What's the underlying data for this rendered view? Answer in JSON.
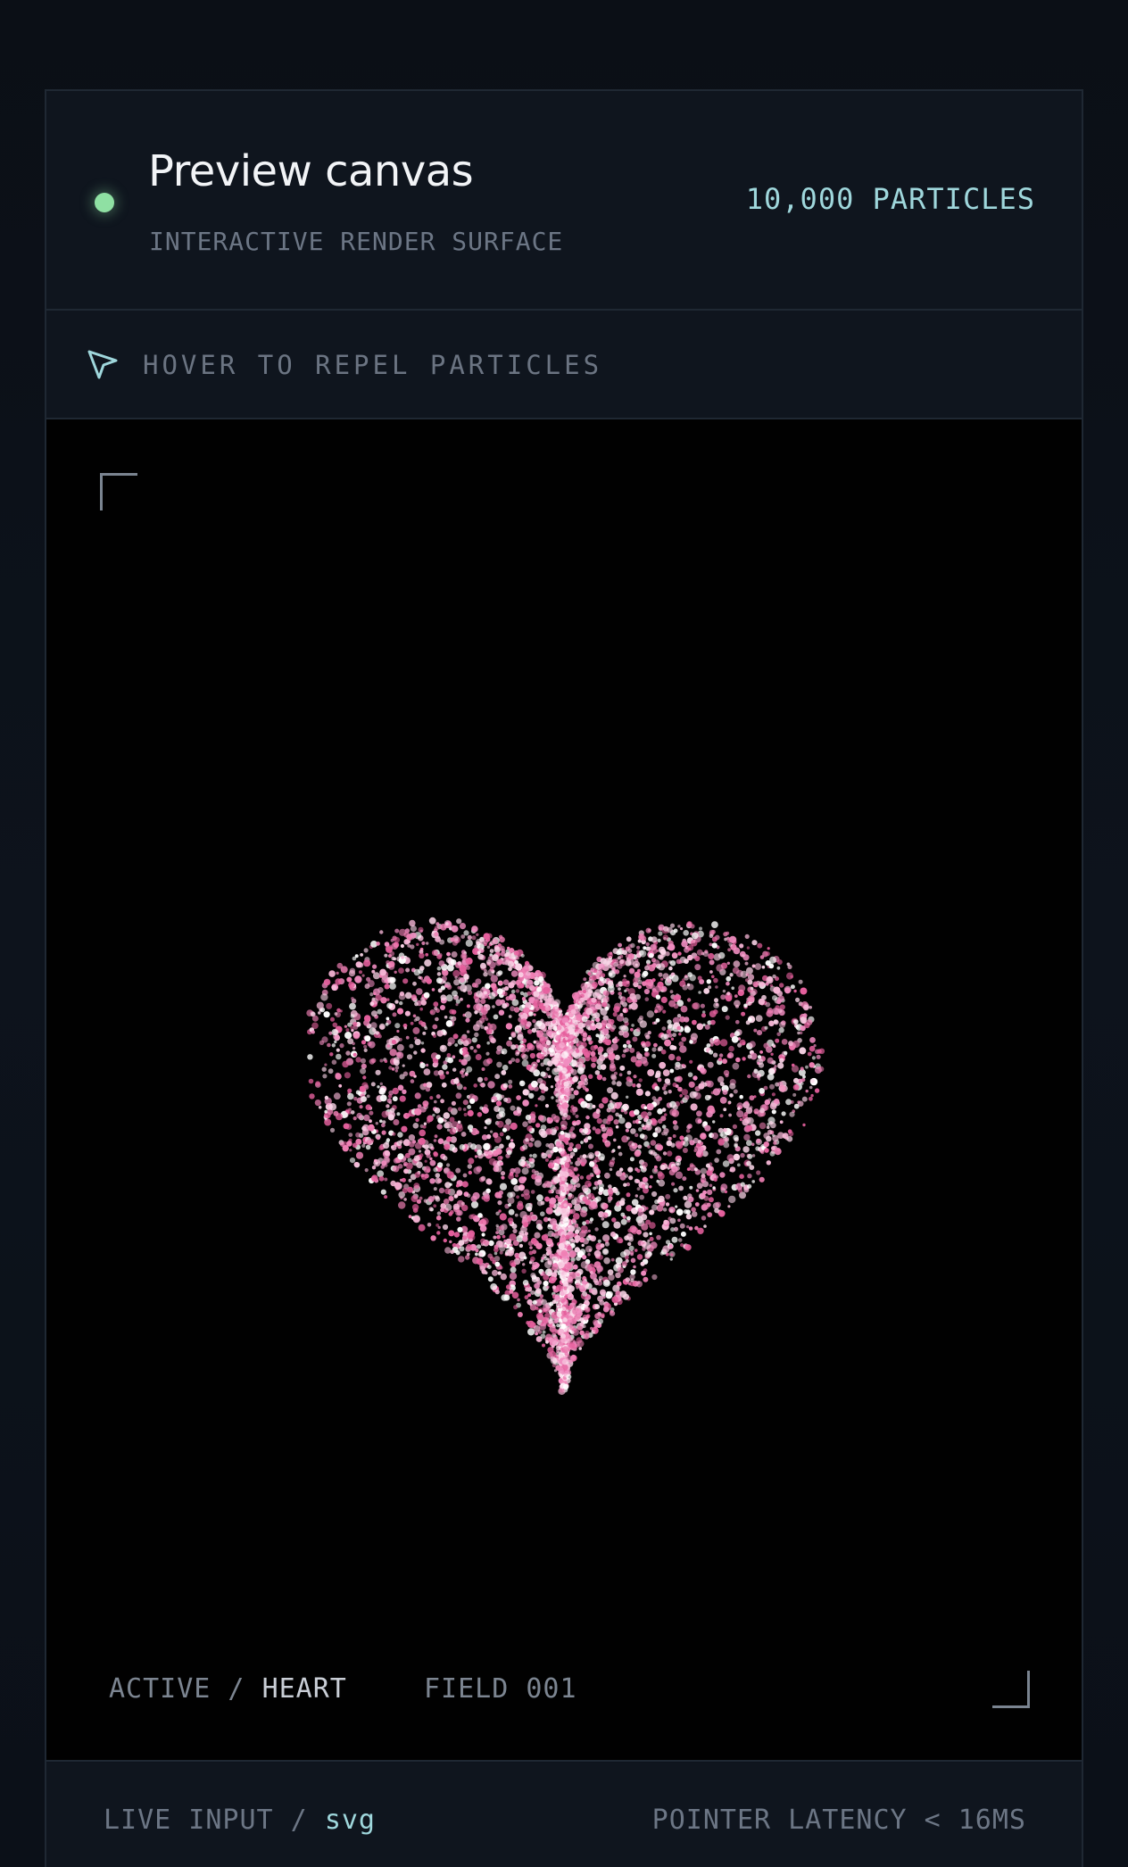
{
  "header": {
    "title": "Preview canvas",
    "subtitle": "INTERACTIVE RENDER SURFACE",
    "particle_count": "10,000 PARTICLES",
    "status_color": "#8fe0a3"
  },
  "hint": {
    "icon": "cursor-arrow-icon",
    "text": "HOVER TO REPEL PARTICLES"
  },
  "canvas": {
    "shape": "heart",
    "particle_color": "#f08cc0",
    "background": "#010101",
    "footer": {
      "active_label": "ACTIVE /",
      "active_shape": "HEART",
      "field_label": "FIELD 001"
    }
  },
  "footer": {
    "input_label": "LIVE INPUT /",
    "input_type": "svg",
    "latency": "POINTER LATENCY < 16MS"
  },
  "colors": {
    "accent": "#9fd7dc",
    "border": "#1f2833",
    "panel": "#0f151e"
  }
}
